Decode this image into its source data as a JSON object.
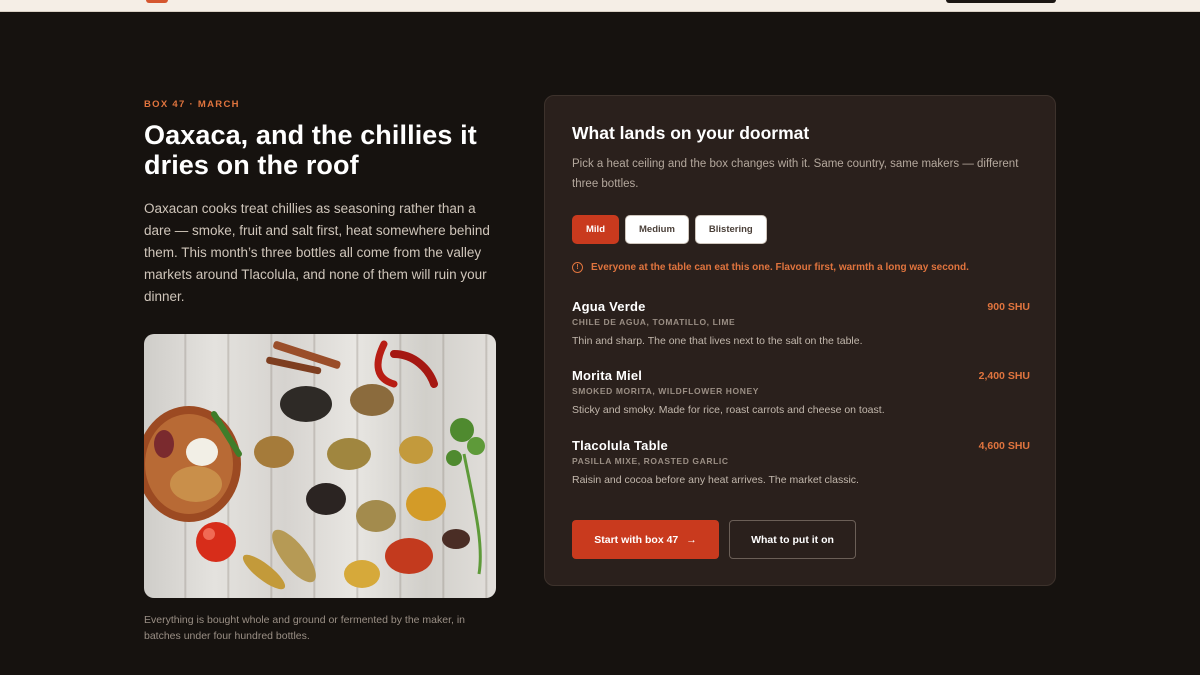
{
  "colors": {
    "accent": "#c93a1e",
    "accent_text": "#e0743e",
    "background": "#16120f",
    "card": "#2a201c"
  },
  "left": {
    "eyebrow": "BOX 47 · MARCH",
    "headline": "Oaxaca, and the chillies it dries on the roof",
    "intro": "Oaxacan cooks treat chillies as seasoning rather than a dare — smoke, fruit and salt first, heat somewhere behind them. This month’s three bottles all come from the valley markets around Tlacolula, and none of them will ruin your dinner.",
    "caption": "Everything is bought whole and ground or fermented by the maker, in batches under four hundred bottles."
  },
  "card": {
    "title": "What lands on your doormat",
    "subtitle": "Pick a heat ceiling and the box changes with it. Same country, same makers — different three bottles.",
    "heat_levels": [
      {
        "label": "Mild",
        "active": true
      },
      {
        "label": "Medium",
        "active": false
      },
      {
        "label": "Blistering",
        "active": false
      }
    ],
    "notice_icon": "info-icon",
    "notice": "Everyone at the table can eat this one. Flavour first, warmth a long way second.",
    "sauces": [
      {
        "name": "Agua Verde",
        "shu": "900 SHU",
        "ingredients": "CHILE DE AGUA, TOMATILLO, LIME",
        "desc": "Thin and sharp. The one that lives next to the salt on the table."
      },
      {
        "name": "Morita Miel",
        "shu": "2,400 SHU",
        "ingredients": "SMOKED MORITA, WILDFLOWER HONEY",
        "desc": "Sticky and smoky. Made for rice, roast carrots and cheese on toast."
      },
      {
        "name": "Tlacolula Table",
        "shu": "4,600 SHU",
        "ingredients": "PASILLA MIXE, ROASTED GARLIC",
        "desc": "Raisin and cocoa before any heat arrives. The market classic."
      }
    ],
    "cta_primary": "Start with box 47",
    "cta_primary_icon": "arrow-right-icon",
    "cta_secondary": "What to put it on"
  }
}
